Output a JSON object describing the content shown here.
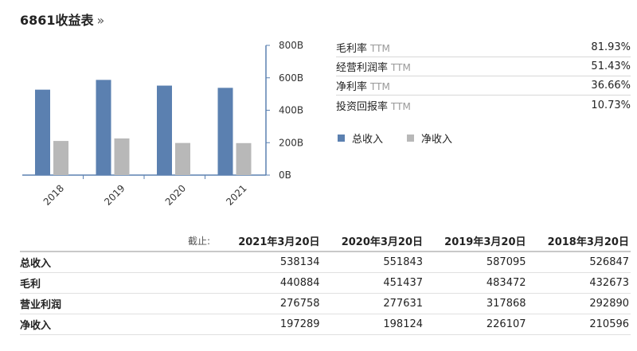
{
  "header": {
    "title": "6861收益表",
    "chevron": "»"
  },
  "ratios": [
    {
      "label": "毛利率",
      "suffix": "TTM",
      "value": "81.93%"
    },
    {
      "label": "经营利润率",
      "suffix": "TTM",
      "value": "51.43%"
    },
    {
      "label": "净利率",
      "suffix": "TTM",
      "value": "36.66%"
    },
    {
      "label": "投资回报率",
      "suffix": "TTM",
      "value": "10.73%"
    }
  ],
  "legend": [
    {
      "label": "总收入",
      "color": "#5b80b0"
    },
    {
      "label": "净收入",
      "color": "#b8b8b8"
    }
  ],
  "chart_data": {
    "type": "bar",
    "categories": [
      "2018",
      "2019",
      "2020",
      "2021"
    ],
    "series": [
      {
        "name": "总收入",
        "color": "#5b80b0",
        "values": [
          526847,
          587095,
          551843,
          538134
        ]
      },
      {
        "name": "净收入",
        "color": "#b8b8b8",
        "values": [
          210596,
          226107,
          198124,
          197289
        ]
      }
    ],
    "y_ticks": [
      "0B",
      "200B",
      "400B",
      "600B",
      "800B"
    ],
    "ylim": [
      0,
      800000
    ],
    "y_axis_position": "right",
    "grid": false
  },
  "table": {
    "as_of_label": "截止:",
    "columns": [
      "2021年3月20日",
      "2020年3月20日",
      "2019年3月20日",
      "2018年3月20日"
    ],
    "rows": [
      {
        "label": "总收入",
        "values": [
          "538134",
          "551843",
          "587095",
          "526847"
        ]
      },
      {
        "label": "毛利",
        "values": [
          "440884",
          "451437",
          "483472",
          "432673"
        ]
      },
      {
        "label": "营业利润",
        "values": [
          "276758",
          "277631",
          "317868",
          "292890"
        ]
      },
      {
        "label": "净收入",
        "values": [
          "197289",
          "198124",
          "226107",
          "210596"
        ]
      }
    ]
  }
}
